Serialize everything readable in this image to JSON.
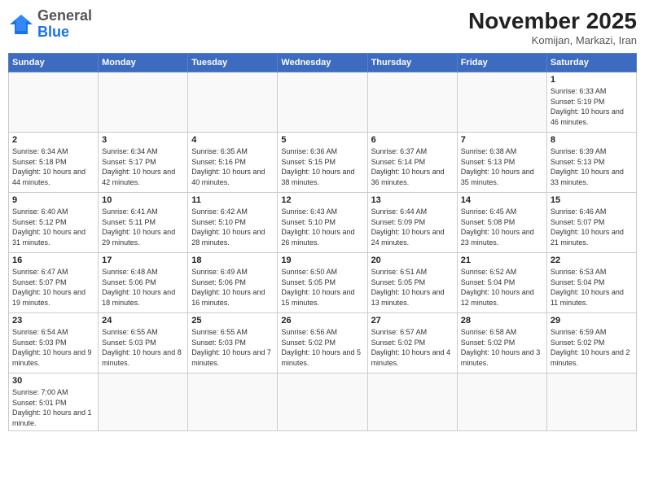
{
  "logo": {
    "general": "General",
    "blue": "Blue"
  },
  "title": {
    "month_year": "November 2025",
    "location": "Komijan, Markazi, Iran"
  },
  "weekdays": [
    "Sunday",
    "Monday",
    "Tuesday",
    "Wednesday",
    "Thursday",
    "Friday",
    "Saturday"
  ],
  "weeks": [
    [
      {
        "day": "",
        "info": ""
      },
      {
        "day": "",
        "info": ""
      },
      {
        "day": "",
        "info": ""
      },
      {
        "day": "",
        "info": ""
      },
      {
        "day": "",
        "info": ""
      },
      {
        "day": "",
        "info": ""
      },
      {
        "day": "1",
        "info": "Sunrise: 6:33 AM\nSunset: 5:19 PM\nDaylight: 10 hours and 46 minutes."
      }
    ],
    [
      {
        "day": "2",
        "info": "Sunrise: 6:34 AM\nSunset: 5:18 PM\nDaylight: 10 hours and 44 minutes."
      },
      {
        "day": "3",
        "info": "Sunrise: 6:34 AM\nSunset: 5:17 PM\nDaylight: 10 hours and 42 minutes."
      },
      {
        "day": "4",
        "info": "Sunrise: 6:35 AM\nSunset: 5:16 PM\nDaylight: 10 hours and 40 minutes."
      },
      {
        "day": "5",
        "info": "Sunrise: 6:36 AM\nSunset: 5:15 PM\nDaylight: 10 hours and 38 minutes."
      },
      {
        "day": "6",
        "info": "Sunrise: 6:37 AM\nSunset: 5:14 PM\nDaylight: 10 hours and 36 minutes."
      },
      {
        "day": "7",
        "info": "Sunrise: 6:38 AM\nSunset: 5:13 PM\nDaylight: 10 hours and 35 minutes."
      },
      {
        "day": "8",
        "info": "Sunrise: 6:39 AM\nSunset: 5:13 PM\nDaylight: 10 hours and 33 minutes."
      }
    ],
    [
      {
        "day": "9",
        "info": "Sunrise: 6:40 AM\nSunset: 5:12 PM\nDaylight: 10 hours and 31 minutes."
      },
      {
        "day": "10",
        "info": "Sunrise: 6:41 AM\nSunset: 5:11 PM\nDaylight: 10 hours and 29 minutes."
      },
      {
        "day": "11",
        "info": "Sunrise: 6:42 AM\nSunset: 5:10 PM\nDaylight: 10 hours and 28 minutes."
      },
      {
        "day": "12",
        "info": "Sunrise: 6:43 AM\nSunset: 5:10 PM\nDaylight: 10 hours and 26 minutes."
      },
      {
        "day": "13",
        "info": "Sunrise: 6:44 AM\nSunset: 5:09 PM\nDaylight: 10 hours and 24 minutes."
      },
      {
        "day": "14",
        "info": "Sunrise: 6:45 AM\nSunset: 5:08 PM\nDaylight: 10 hours and 23 minutes."
      },
      {
        "day": "15",
        "info": "Sunrise: 6:46 AM\nSunset: 5:07 PM\nDaylight: 10 hours and 21 minutes."
      }
    ],
    [
      {
        "day": "16",
        "info": "Sunrise: 6:47 AM\nSunset: 5:07 PM\nDaylight: 10 hours and 19 minutes."
      },
      {
        "day": "17",
        "info": "Sunrise: 6:48 AM\nSunset: 5:06 PM\nDaylight: 10 hours and 18 minutes."
      },
      {
        "day": "18",
        "info": "Sunrise: 6:49 AM\nSunset: 5:06 PM\nDaylight: 10 hours and 16 minutes."
      },
      {
        "day": "19",
        "info": "Sunrise: 6:50 AM\nSunset: 5:05 PM\nDaylight: 10 hours and 15 minutes."
      },
      {
        "day": "20",
        "info": "Sunrise: 6:51 AM\nSunset: 5:05 PM\nDaylight: 10 hours and 13 minutes."
      },
      {
        "day": "21",
        "info": "Sunrise: 6:52 AM\nSunset: 5:04 PM\nDaylight: 10 hours and 12 minutes."
      },
      {
        "day": "22",
        "info": "Sunrise: 6:53 AM\nSunset: 5:04 PM\nDaylight: 10 hours and 11 minutes."
      }
    ],
    [
      {
        "day": "23",
        "info": "Sunrise: 6:54 AM\nSunset: 5:03 PM\nDaylight: 10 hours and 9 minutes."
      },
      {
        "day": "24",
        "info": "Sunrise: 6:55 AM\nSunset: 5:03 PM\nDaylight: 10 hours and 8 minutes."
      },
      {
        "day": "25",
        "info": "Sunrise: 6:55 AM\nSunset: 5:03 PM\nDaylight: 10 hours and 7 minutes."
      },
      {
        "day": "26",
        "info": "Sunrise: 6:56 AM\nSunset: 5:02 PM\nDaylight: 10 hours and 5 minutes."
      },
      {
        "day": "27",
        "info": "Sunrise: 6:57 AM\nSunset: 5:02 PM\nDaylight: 10 hours and 4 minutes."
      },
      {
        "day": "28",
        "info": "Sunrise: 6:58 AM\nSunset: 5:02 PM\nDaylight: 10 hours and 3 minutes."
      },
      {
        "day": "29",
        "info": "Sunrise: 6:59 AM\nSunset: 5:02 PM\nDaylight: 10 hours and 2 minutes."
      }
    ],
    [
      {
        "day": "30",
        "info": "Sunrise: 7:00 AM\nSunset: 5:01 PM\nDaylight: 10 hours and 1 minute."
      },
      {
        "day": "",
        "info": ""
      },
      {
        "day": "",
        "info": ""
      },
      {
        "day": "",
        "info": ""
      },
      {
        "day": "",
        "info": ""
      },
      {
        "day": "",
        "info": ""
      },
      {
        "day": "",
        "info": ""
      }
    ]
  ]
}
